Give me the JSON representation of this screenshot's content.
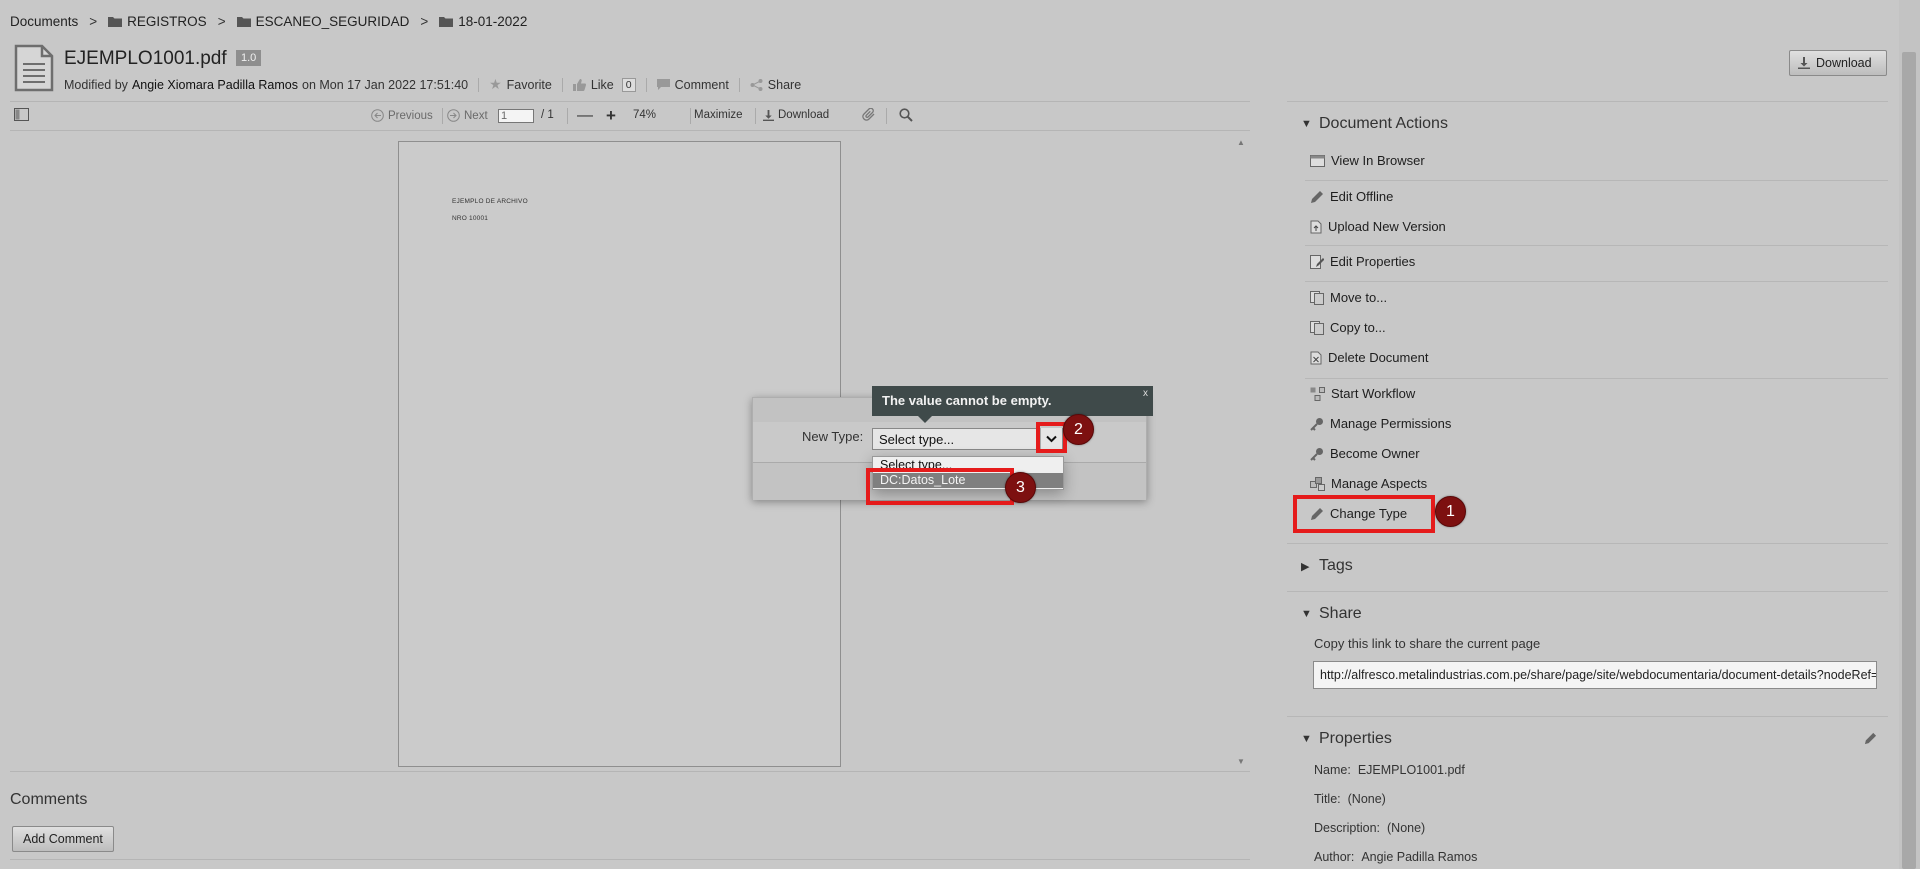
{
  "breadcrumb": {
    "root": "Documents",
    "items": [
      "REGISTROS",
      "ESCANEO_SEGURIDAD",
      "18-01-2022"
    ],
    "separator": ">"
  },
  "document": {
    "file_name": "EJEMPLO1001.pdf",
    "version": "1.0",
    "modified_prefix": "Modified by",
    "modified_user": "Angie Xiomara Padilla Ramos",
    "modified_on": "on Mon 17 Jan 2022 17:51:40",
    "actions": {
      "favorite": "Favorite",
      "like": "Like",
      "like_count": "0",
      "comment": "Comment",
      "share": "Share"
    }
  },
  "header": {
    "download_label": "Download"
  },
  "viewer": {
    "previous": "Previous",
    "next": "Next",
    "page_value": "1",
    "page_total": "/ 1",
    "zoom": "74%",
    "maximize": "Maximize",
    "download": "Download",
    "page_lines": [
      "EJEMPLO DE ARCHIVO",
      "NRO 10001"
    ]
  },
  "comments": {
    "heading": "Comments",
    "add_label": "Add Comment"
  },
  "document_actions": {
    "heading": "Document Actions",
    "items": [
      {
        "label": "View In Browser",
        "icon": "view-in-browser-icon"
      },
      {
        "label": "Edit Offline",
        "icon": "pencil-icon"
      },
      {
        "label": "Upload New Version",
        "icon": "upload-icon"
      },
      {
        "label": "Edit Properties",
        "icon": "edit-properties-icon"
      },
      {
        "label": "Move to...",
        "icon": "move-icon"
      },
      {
        "label": "Copy to...",
        "icon": "copy-icon"
      },
      {
        "label": "Delete Document",
        "icon": "delete-icon"
      },
      {
        "label": "Start Workflow",
        "icon": "workflow-icon"
      },
      {
        "label": "Manage Permissions",
        "icon": "key-icon"
      },
      {
        "label": "Become Owner",
        "icon": "key-icon"
      },
      {
        "label": "Manage Aspects",
        "icon": "aspects-icon"
      },
      {
        "label": "Change Type",
        "icon": "pencil-icon"
      }
    ]
  },
  "tags": {
    "heading": "Tags"
  },
  "share": {
    "heading": "Share",
    "description": "Copy this link to share the current page",
    "link": "http://alfresco.metalindustrias.com.pe/share/page/site/webdocumentaria/document-details?nodeRef=workspace://SpacesStore/"
  },
  "properties": {
    "heading": "Properties",
    "items": [
      {
        "key": "Name:",
        "value": "EJEMPLO1001.pdf"
      },
      {
        "key": "Title:",
        "value": "(None)"
      },
      {
        "key": "Description:",
        "value": "(None)"
      },
      {
        "key": "Author:",
        "value": "Angie Padilla Ramos"
      }
    ]
  },
  "change_type_dialog": {
    "label": "New Type:",
    "selected": "Select type...",
    "options": [
      "Select type...",
      "DC:Datos_Lote"
    ],
    "highlighted_option": "DC:Datos_Lote",
    "tooltip": "The value cannot be empty.",
    "tooltip_close": "x"
  },
  "annotations": [
    "1",
    "2",
    "3"
  ],
  "colors": {
    "highlight": "#e51b1b",
    "badge": "#7d1010",
    "tooltip_bg": "#3f4a4a"
  }
}
